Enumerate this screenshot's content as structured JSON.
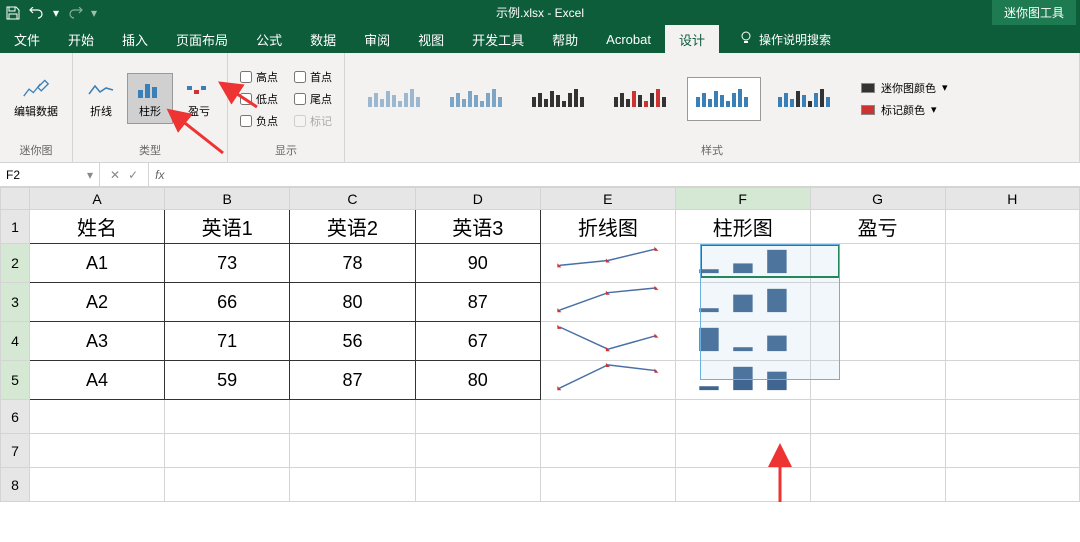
{
  "titlebar": {
    "title": "示例.xlsx - Excel",
    "context_tool": "迷你图工具"
  },
  "tabs": {
    "file": "文件",
    "home": "开始",
    "insert": "插入",
    "pagelayout": "页面布局",
    "formulas": "公式",
    "data": "数据",
    "review": "审阅",
    "view": "视图",
    "developer": "开发工具",
    "help": "帮助",
    "acrobat": "Acrobat",
    "design": "设计",
    "tellme": "操作说明搜索"
  },
  "ribbon": {
    "sparkline_group": "迷你图",
    "edit_data": "编辑数据",
    "type_group": "类型",
    "line": "折线",
    "column": "柱形",
    "winloss": "盈亏",
    "show_group": "显示",
    "high": "高点",
    "low": "低点",
    "neg": "负点",
    "first": "首点",
    "last": "尾点",
    "markers": "标记",
    "style_group": "样式",
    "spark_color": "迷你图颜色",
    "marker_color": "标记颜色"
  },
  "formula_bar": {
    "cell_ref": "F2"
  },
  "columns": [
    "A",
    "B",
    "C",
    "D",
    "E",
    "F",
    "G",
    "H"
  ],
  "headers": {
    "name": "姓名",
    "e1": "英语1",
    "e2": "英语2",
    "e3": "英语3",
    "line": "折线图",
    "col": "柱形图",
    "wl": "盈亏"
  },
  "rows": [
    {
      "name": "A1",
      "e1": "73",
      "e2": "78",
      "e3": "90"
    },
    {
      "name": "A2",
      "e1": "66",
      "e2": "80",
      "e3": "87"
    },
    {
      "name": "A3",
      "e1": "71",
      "e2": "56",
      "e3": "67"
    },
    {
      "name": "A4",
      "e1": "59",
      "e2": "87",
      "e3": "80"
    }
  ],
  "chart_data": {
    "type": "sparkline",
    "series": [
      {
        "name": "A1",
        "values": [
          73,
          78,
          90
        ]
      },
      {
        "name": "A2",
        "values": [
          66,
          80,
          87
        ]
      },
      {
        "name": "A3",
        "values": [
          71,
          56,
          67
        ]
      },
      {
        "name": "A4",
        "values": [
          59,
          87,
          80
        ]
      }
    ]
  }
}
